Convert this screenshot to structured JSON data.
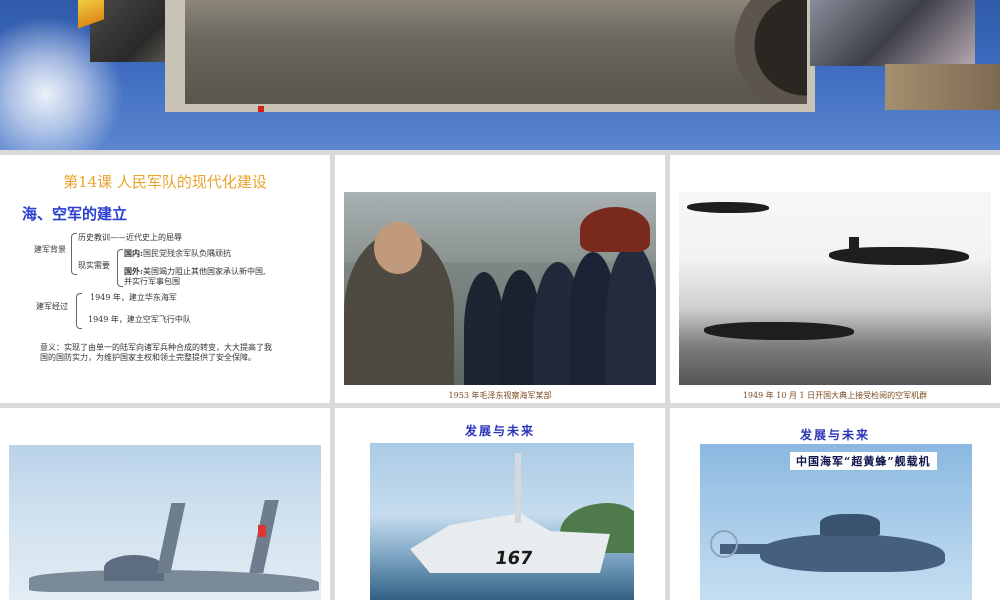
{
  "slides": {
    "s1": {
      "title": "第14课  人民军队的现代化建设",
      "subtitle": "海、空军的建立",
      "background_label": "建军背景",
      "history_lesson": "历史教训——近代史上的屈辱",
      "real_need_label": "现实需要",
      "domestic_label": "国内:",
      "domestic_text": "国民党残余军队负隅顽抗",
      "foreign_label": "国外:",
      "foreign_text_1": "美国竭力阻止其他国家承认新中国,",
      "foreign_text_2": "并实行军事包围",
      "process_label": "建军经过",
      "navy_event": "1949 年，建立华东海军",
      "airforce_event": "1949 年，建立空军飞行中队",
      "meaning_1": "意义：实现了由单一的陆军向诸军兵种合成的转变，大大提高了我",
      "meaning_2": "国的国防实力，为维护国家主权和领土完整提供了安全保障。"
    },
    "s2": {
      "caption": "1953 年毛泽东视察海军某部"
    },
    "s3": {
      "caption": "1949 年 10 月 1 日开国大典上接受检阅的空军机群"
    },
    "s5": {
      "heading": "发展与未来",
      "hull_number": "167"
    },
    "s6": {
      "heading": "发展与未来",
      "label": "中国海军“超黄蜂”舰载机"
    }
  },
  "colors": {
    "title_orange": "#e9a32a",
    "heading_blue": "#2a3fd0",
    "caption_brown": "#7a4a1c",
    "slide_bg": "#ffffff",
    "sorter_bg": "#d9d9d9"
  }
}
